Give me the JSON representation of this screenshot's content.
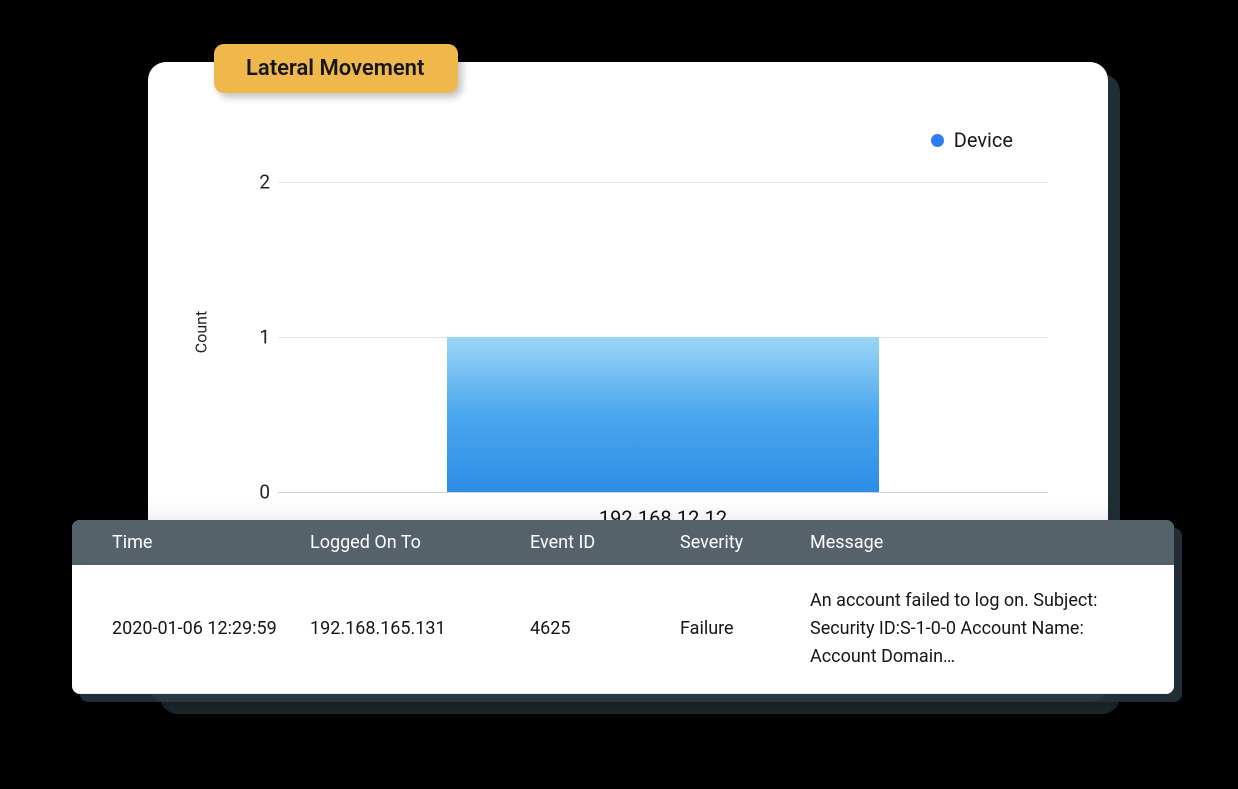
{
  "badge": {
    "label": "Lateral Movement"
  },
  "legend": {
    "series_label": "Device"
  },
  "chart_data": {
    "type": "bar",
    "categories": [
      "192.168.12.12"
    ],
    "values": [
      1
    ],
    "title": "",
    "xlabel": "",
    "ylabel": "Count",
    "ylim": [
      0,
      2
    ],
    "legend": "Device",
    "legend_position": "top-right",
    "series": [
      {
        "name": "Device",
        "values": [
          1
        ]
      }
    ],
    "yticks": [
      "0",
      "1",
      "2"
    ]
  },
  "table": {
    "headers": {
      "time": "Time",
      "logged_on_to": "Logged On To",
      "event_id": "Event ID",
      "severity": "Severity",
      "message": "Message"
    },
    "rows": [
      {
        "time": "2020-01-06 12:29:59",
        "logged_on_to": "192.168.165.131",
        "event_id": "4625",
        "severity": "Failure",
        "message": "An account failed to log on. Subject: Security ID:S-1-0-0 Account Name: Account Domain…"
      }
    ]
  }
}
